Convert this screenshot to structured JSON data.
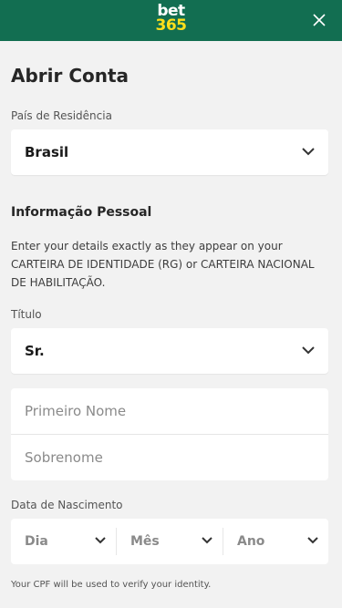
{
  "header": {
    "logo_top": "bet",
    "logo_bottom": "365",
    "close_icon": "close-icon",
    "background": "#126e51",
    "logo_accent": "#ffdf1b"
  },
  "form": {
    "title": "Abrir Conta",
    "country": {
      "label": "País de Residência",
      "value": "Brasil",
      "icon": "chevron-down-icon"
    },
    "personal_info": {
      "title": "Informação Pessoal",
      "description": "Enter your details exactly as they appear on your CARTEIRA DE IDENTIDADE (RG) or CARTEIRA NACIONAL DE HABILITAÇÃO."
    },
    "title_field": {
      "label": "Título",
      "value": "Sr.",
      "icon": "chevron-down-icon"
    },
    "first_name": {
      "placeholder": "Primeiro Nome",
      "value": ""
    },
    "last_name": {
      "placeholder": "Sobrenome",
      "value": ""
    },
    "dob": {
      "label": "Data de Nascimento",
      "day": "Dia",
      "month": "Mês",
      "year": "Ano"
    },
    "cpf_note": "Your CPF will be used to verify your identity."
  }
}
